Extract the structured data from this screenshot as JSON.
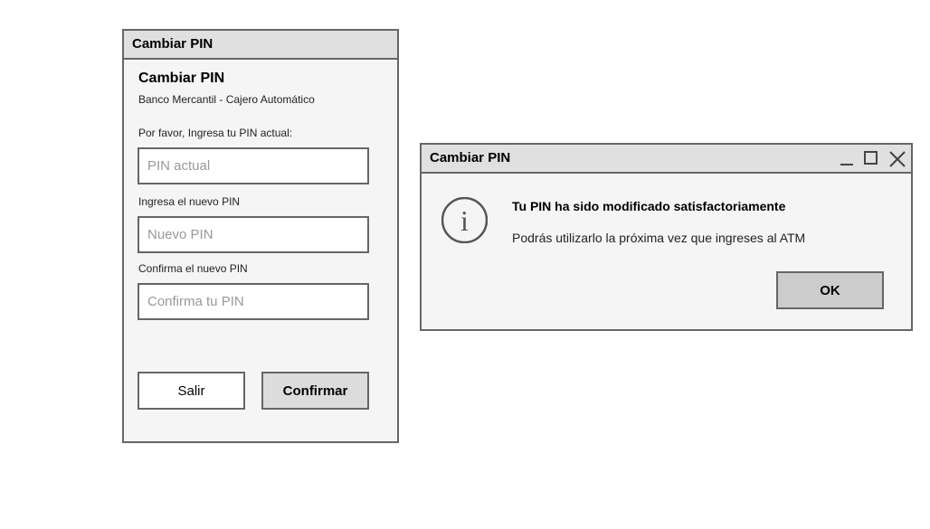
{
  "form_window": {
    "title": "Cambiar PIN",
    "heading": "Cambiar PIN",
    "subtitle": "Banco Mercantil - Cajero Automático",
    "current_pin_label": "Por favor, Ingresa tu PIN actual:",
    "current_pin_placeholder": "PIN actual",
    "new_pin_label": "Ingresa el nuevo PIN",
    "new_pin_placeholder": "Nuevo PIN",
    "confirm_pin_label": "Confirma el nuevo PIN",
    "confirm_pin_placeholder": "Confirma tu PIN",
    "exit_button": "Salir",
    "confirm_button": "Confirmar"
  },
  "dialog": {
    "title": "Cambiar PIN",
    "icon": "info-icon",
    "heading": "Tu PIN ha sido modificado satisfactoriamente",
    "message": "Podrás utilizarlo la próxima vez que ingreses al ATM",
    "ok_button": "OK",
    "window_controls": [
      "minimize-icon",
      "maximize-icon",
      "close-icon"
    ]
  },
  "colors": {
    "titlebar": "#e0e0e0",
    "border": "#666666",
    "window_bg": "#f5f5f5",
    "button_primary": "#dcdcdc"
  }
}
